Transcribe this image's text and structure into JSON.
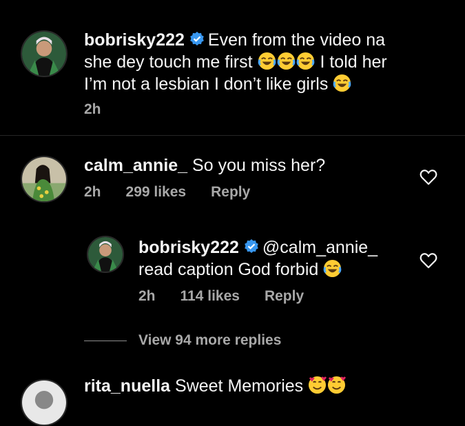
{
  "comments": [
    {
      "username": "bobrisky222",
      "text_parts": [
        "Even from the video na",
        "she dey touch me first",
        "I told her",
        "I’m not a lesbian I don’t like girls"
      ],
      "time": "2h"
    },
    {
      "username": "calm_annie_",
      "text": "So you miss her?",
      "time": "2h",
      "likes": "299 likes",
      "reply_label": "Reply"
    }
  ],
  "reply": {
    "username": "bobrisky222",
    "mention": "@calm_annie_",
    "text": "read caption God forbid",
    "time": "2h",
    "likes": "114 likes",
    "reply_label": "Reply"
  },
  "view_more": "View 94 more replies",
  "partial_comment": {
    "username": "rita_nuella",
    "text": "Sweet Memories"
  },
  "colors": {
    "background": "#000000",
    "meta_text": "#a8a8a8",
    "verified": "#3897f0"
  }
}
